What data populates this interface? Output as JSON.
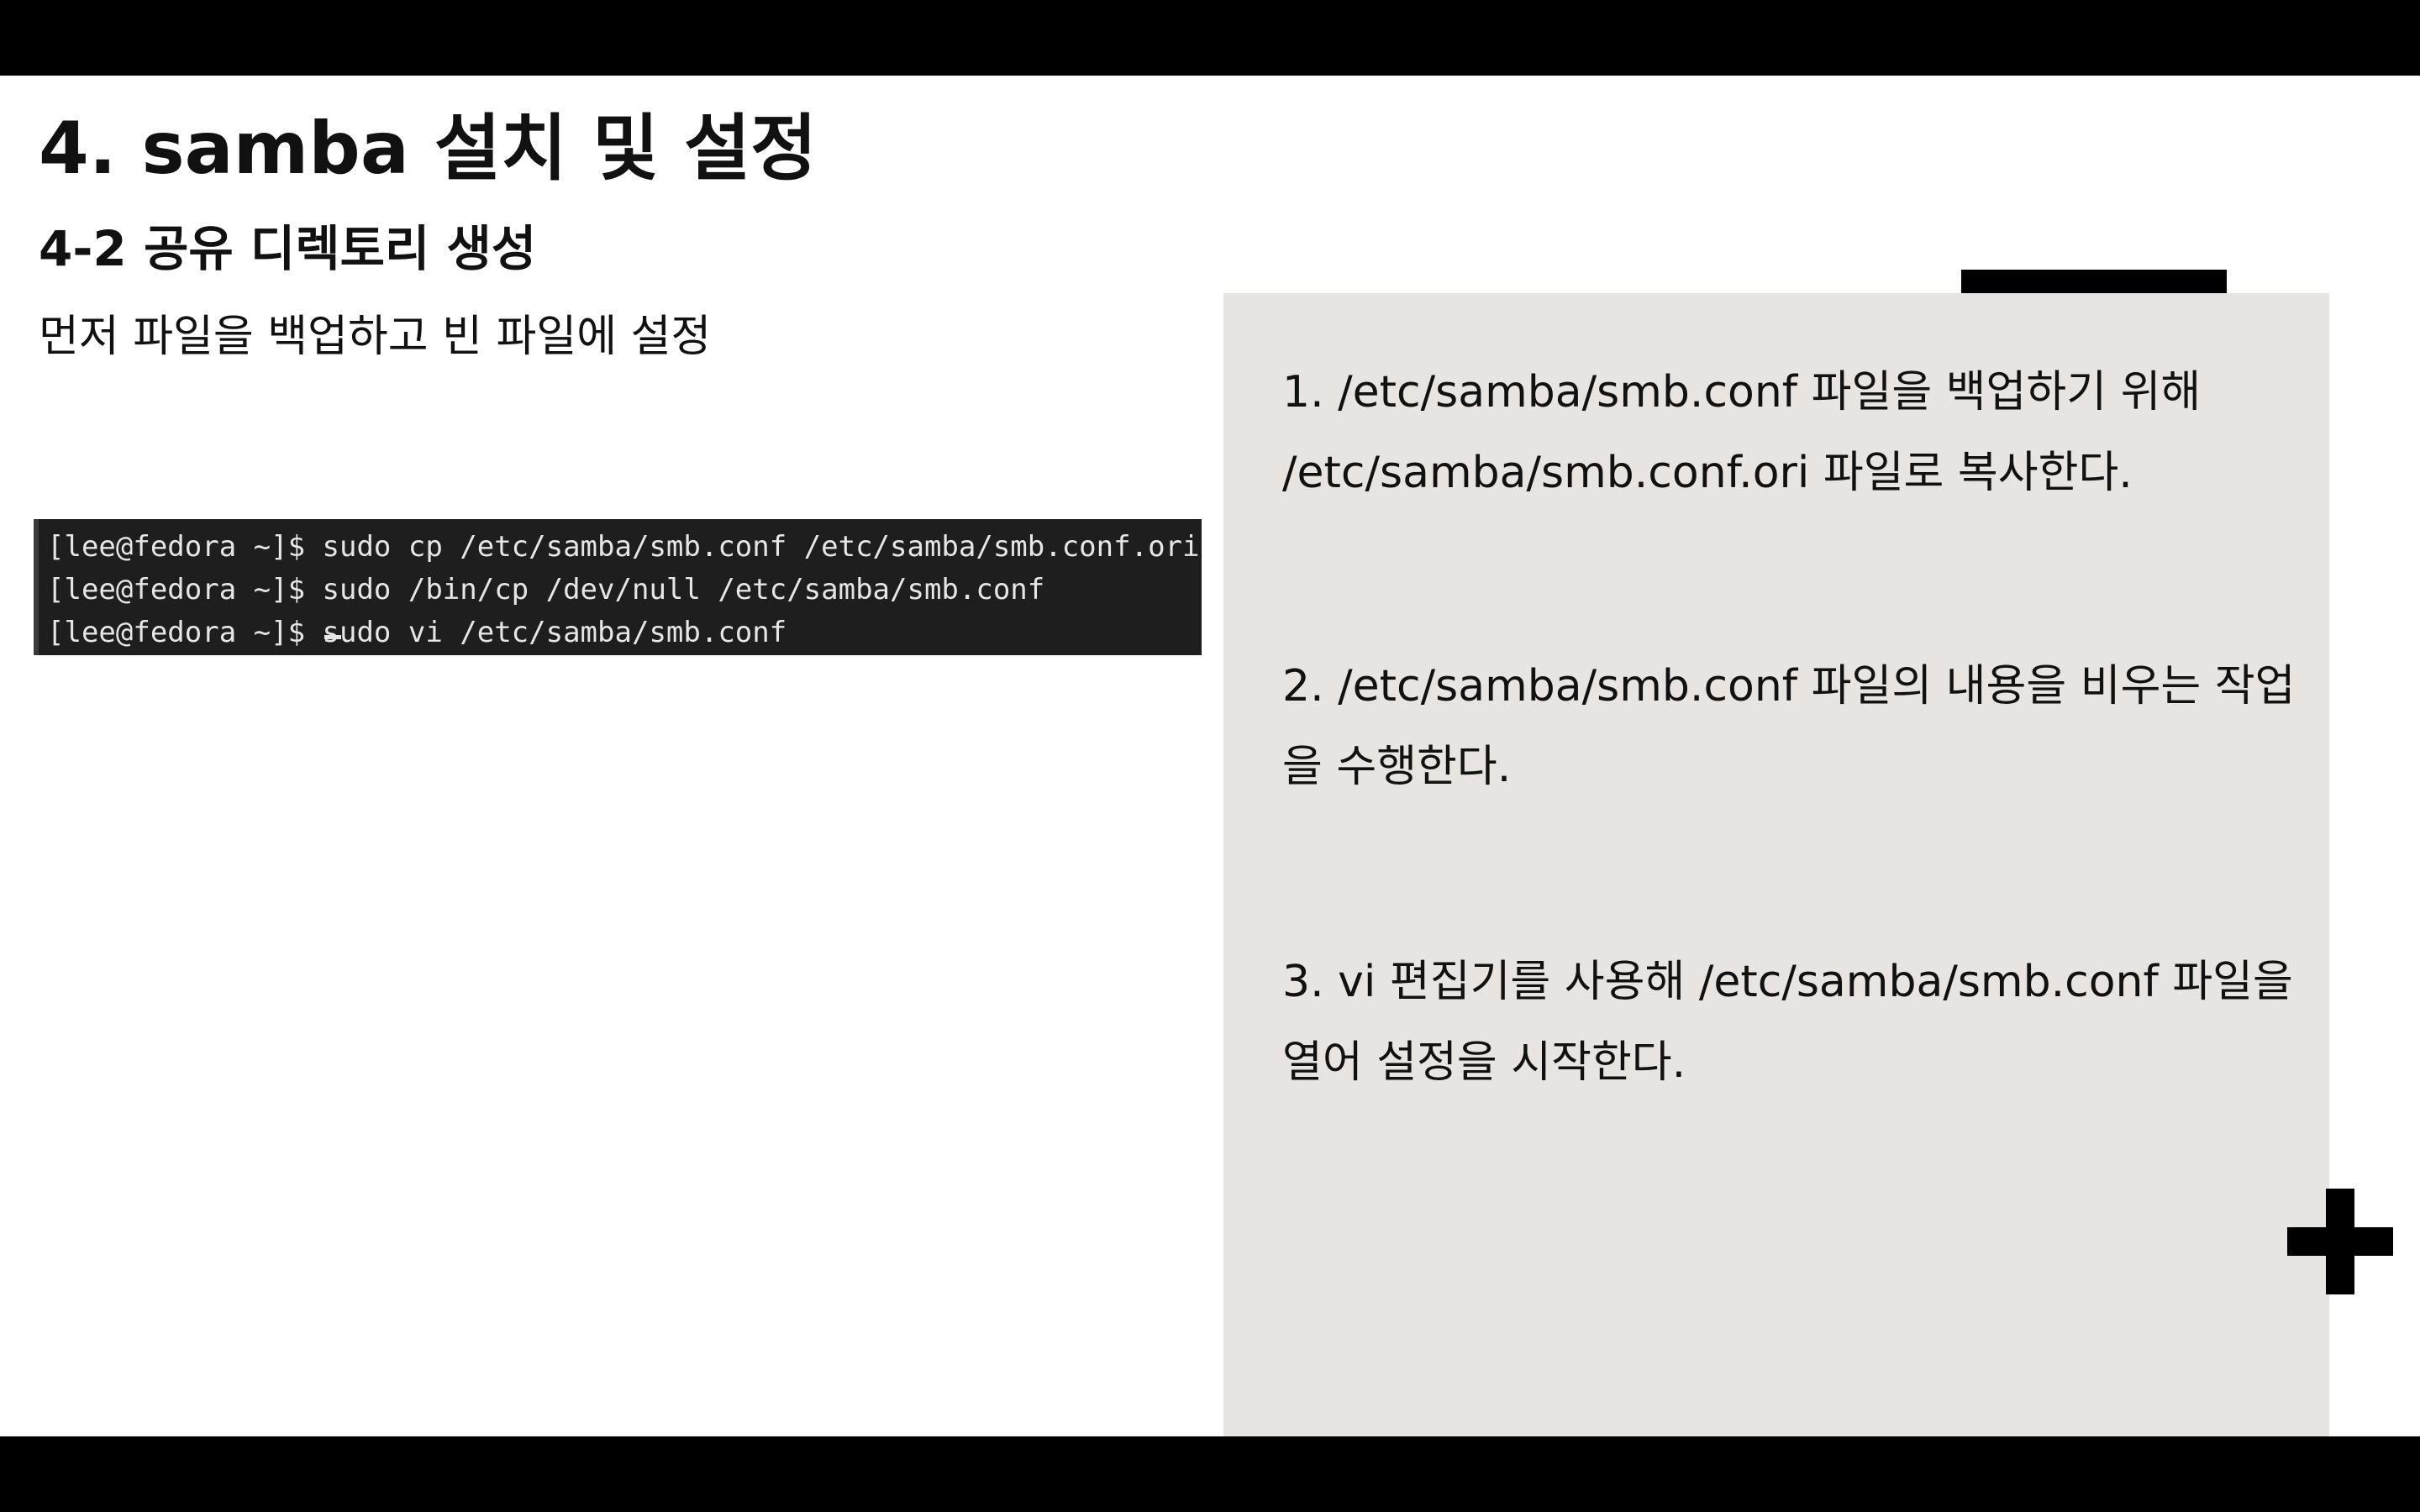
{
  "slide": {
    "title": "4. samba 설치 및 설정",
    "subtitle": "4-2 공유 디렉토리 생성",
    "intro": "먼저 파일을 백업하고 빈 파일에 설정"
  },
  "terminal": {
    "lines": [
      "[lee@fedora ~]$ sudo cp /etc/samba/smb.conf /etc/samba/smb.conf.ori",
      "[lee@fedora ~]$ sudo /bin/cp /dev/null /etc/samba/smb.conf",
      "[lee@fedora ~]$ sudo vi /etc/samba/smb.conf"
    ]
  },
  "panel": {
    "steps": [
      "1.  /etc/samba/smb.conf 파일을 백업하기 위해 /etc/samba/smb.conf.ori 파일로 복사한다.",
      "2. /etc/samba/smb.conf 파일의 내용을 비우는 작업을 수행한다.",
      "3. vi 편집기를 사용해 /etc/samba/smb.conf 파일을 열어 설정을 시작한다."
    ]
  },
  "colors": {
    "letterbox": "#000000",
    "slide_background": "#ffffff",
    "panel_background": "#e7e4e1",
    "terminal_background": "#1e1e1e",
    "terminal_text": "#e6e6e6",
    "text": "#111111"
  },
  "icons": {
    "decoration": "plus-icon"
  }
}
